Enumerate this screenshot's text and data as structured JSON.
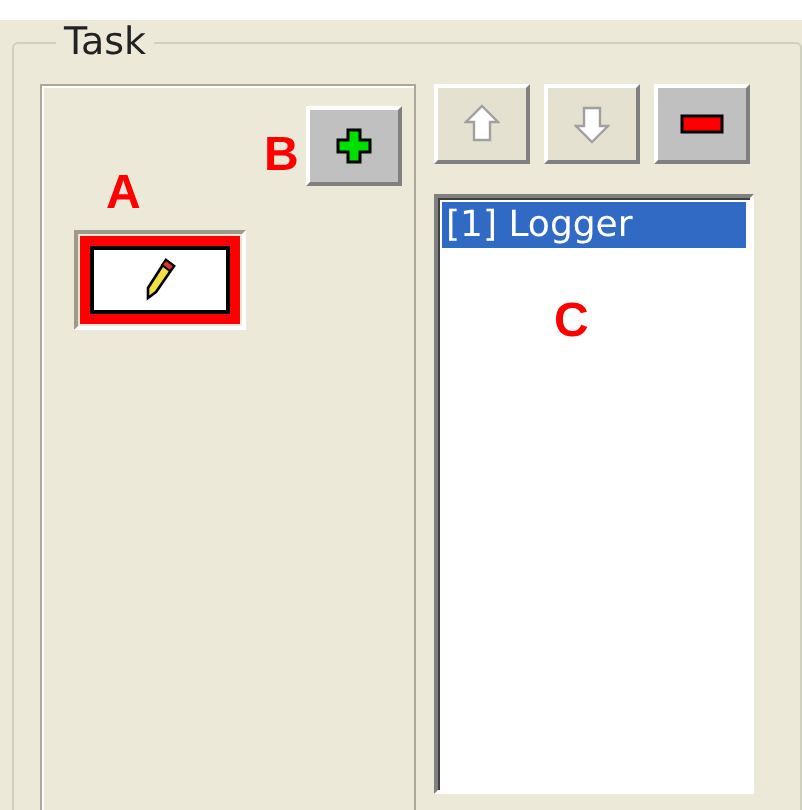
{
  "group": {
    "title": "Task"
  },
  "add_button": {
    "disabled": false
  },
  "toolbar": [
    {
      "kind": "up",
      "disabled": true
    },
    {
      "kind": "down",
      "disabled": true
    },
    {
      "kind": "remove",
      "disabled": false
    }
  ],
  "task_list": {
    "items": [
      {
        "label": "[1] Logger",
        "selected": true
      }
    ]
  },
  "annotations": [
    {
      "kind": "pencil",
      "text": "A"
    },
    {
      "kind": "add",
      "text": "B"
    },
    {
      "kind": "list",
      "text": "C"
    }
  ]
}
